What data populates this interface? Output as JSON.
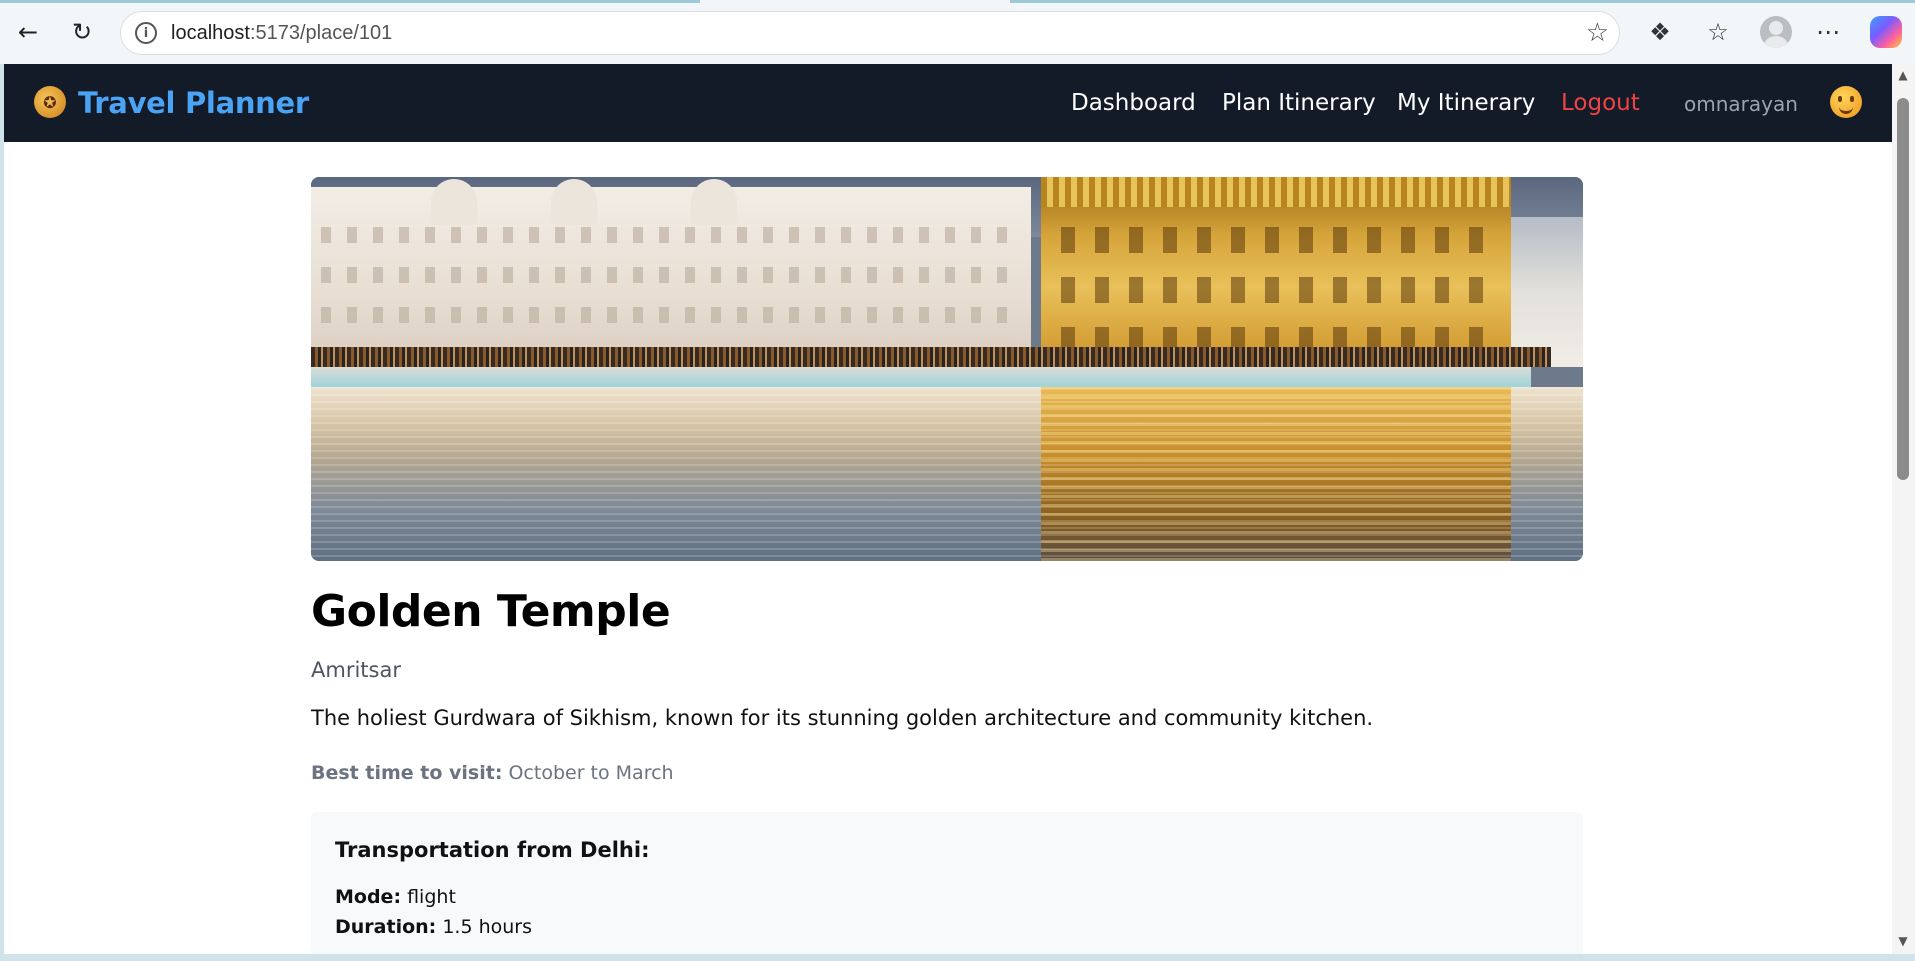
{
  "browser": {
    "url_host": "localhost",
    "url_path": ":5173/place/101",
    "icons": [
      "back-icon",
      "refresh-icon",
      "info-icon",
      "star-icon",
      "extensions-icon",
      "favorites-icon",
      "profile-icon",
      "more-icon",
      "copilot-icon"
    ]
  },
  "navbar": {
    "brand_icon": "compass-icon",
    "brand": "Travel Planner",
    "links": [
      "Dashboard",
      "Plan Itinerary",
      "My Itinerary",
      "Logout"
    ],
    "username": "omnarayan",
    "theme_icon": "sun-face-icon"
  },
  "place": {
    "name": "Golden Temple",
    "city": "Amritsar",
    "description": "The holiest Gurdwara of Sikhism, known for its stunning golden architecture and community kitchen.",
    "best_time_label": "Best time to visit:",
    "best_time_value": "October to March"
  },
  "transport": {
    "title": "Transportation from Delhi:",
    "mode_label": "Mode:",
    "mode_value": "flight",
    "duration_label": "Duration:",
    "duration_value": "1.5 hours"
  },
  "colors": {
    "nav_bg": "#131a28",
    "brand": "#4aa3f5",
    "logout": "#ef4444"
  }
}
